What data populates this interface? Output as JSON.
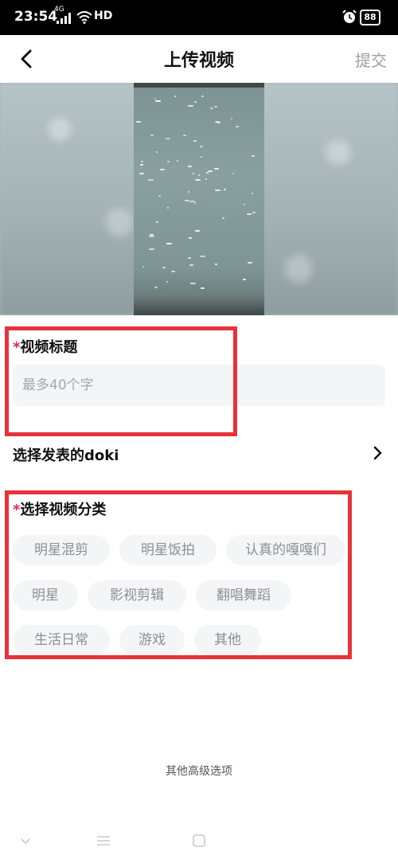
{
  "status_bar": {
    "time": "23:54",
    "network_top": "4G",
    "hd": "HD",
    "battery": "88",
    "icons": [
      "signal-icon",
      "wifi-icon",
      "alarm-icon",
      "battery-icon"
    ]
  },
  "header": {
    "title": "上传视频",
    "submit_label": "提交",
    "back_icon": "chevron-left-icon"
  },
  "video_title": {
    "required_mark": "*",
    "label": "视频标题",
    "placeholder": "最多40个字",
    "value": ""
  },
  "doki": {
    "label": "选择发表的doki",
    "chevron_icon": "chevron-right-icon"
  },
  "category": {
    "required_mark": "*",
    "label": "选择视频分类",
    "options": [
      "明星混剪",
      "明星饭拍",
      "认真的嘎嘎们",
      "明星",
      "影视剪辑",
      "翻唱舞蹈",
      "生活日常",
      "游戏",
      "其他"
    ]
  },
  "advanced_label": "其他高级选项",
  "navbar": {
    "icons": [
      "back-nav-icon",
      "menu-icon",
      "recent-apps-icon"
    ]
  },
  "colors": {
    "required": "#e5226f",
    "highlight": "#e8323a",
    "chip_bg": "#f4f5f7",
    "chip_text": "#8a8f96",
    "submit_text": "#9aa0a6"
  }
}
